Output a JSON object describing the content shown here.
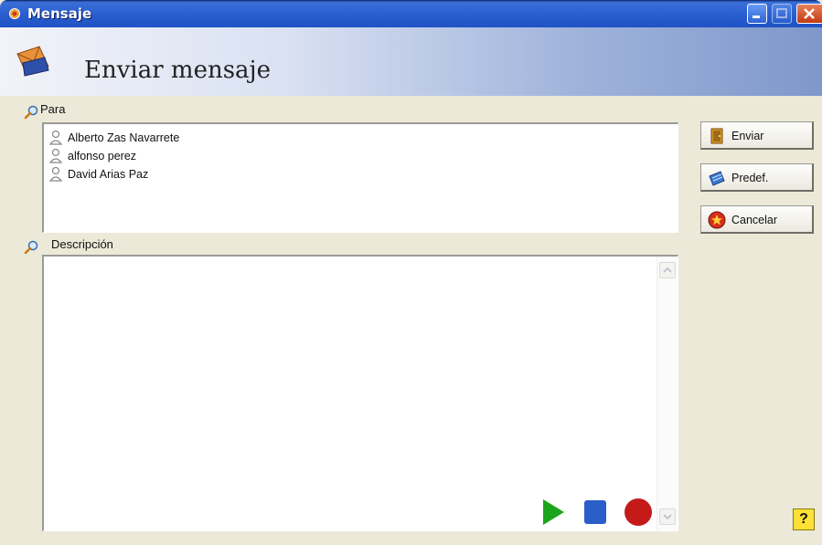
{
  "window": {
    "title": "Mensaje",
    "controls": [
      "minimize-icon",
      "maximize-icon",
      "close-icon"
    ]
  },
  "header": {
    "title": "Enviar mensaje",
    "icon": "envelope-send-icon"
  },
  "para": {
    "label": "Para",
    "icon": "magnifier-icon",
    "recipients": [
      {
        "name": "Alberto Zas Navarrete",
        "icon": "user-icon"
      },
      {
        "name": "alfonso perez",
        "icon": "user-icon"
      },
      {
        "name": "David Arias Paz",
        "icon": "user-icon"
      }
    ]
  },
  "descripcion": {
    "label": "Descripción",
    "icon": "magnifier-icon",
    "value": "",
    "media_controls": [
      "play-icon",
      "stop-icon",
      "record-icon"
    ]
  },
  "actions": {
    "send_label": "Enviar",
    "predef_label": "Predef.",
    "cancel_label": "Cancelar"
  },
  "help": {
    "label": "?"
  },
  "colors": {
    "titlebar": "#2a5fd0",
    "window_bg": "#ece9d8",
    "play": "#1ca51c",
    "stop": "#2a5ec8",
    "record": "#c41a1a",
    "help_bg": "#ffe036"
  }
}
